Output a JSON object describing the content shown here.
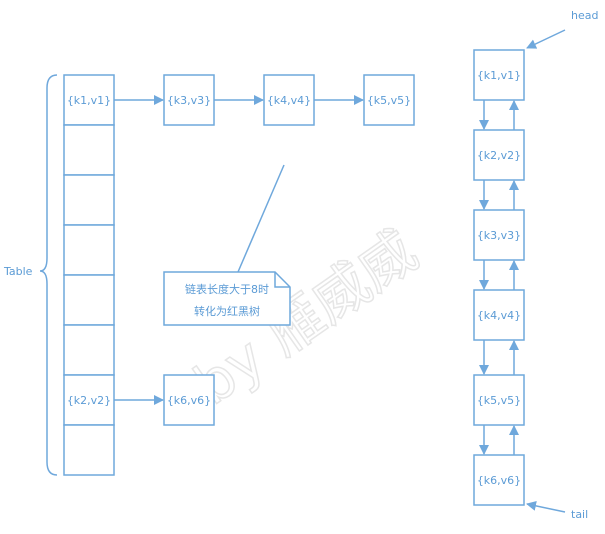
{
  "watermark": "by 雁威威",
  "table": {
    "label": "Table",
    "buckets": [
      "{k1,v1}",
      "",
      "",
      "",
      "",
      "",
      "{k2,v2}",
      ""
    ]
  },
  "chains": [
    {
      "from_bucket": 0,
      "nodes": [
        "{k3,v3}",
        "{k4,v4}",
        "{k5,v5}"
      ]
    },
    {
      "from_bucket": 6,
      "nodes": [
        "{k6,v6}"
      ]
    }
  ],
  "callout": {
    "line1": "链表长度大于8时",
    "line2": "转化为红黑树"
  },
  "linked_list": {
    "head_label": "head",
    "tail_label": "tail",
    "nodes": [
      "{k1,v1}",
      "{k2,v2}",
      "{k3,v3}",
      "{k4,v4}",
      "{k5,v5}",
      "{k6,v6}"
    ]
  },
  "colors": {
    "line": "#6fa8dc",
    "text": "#5b9bd5"
  }
}
